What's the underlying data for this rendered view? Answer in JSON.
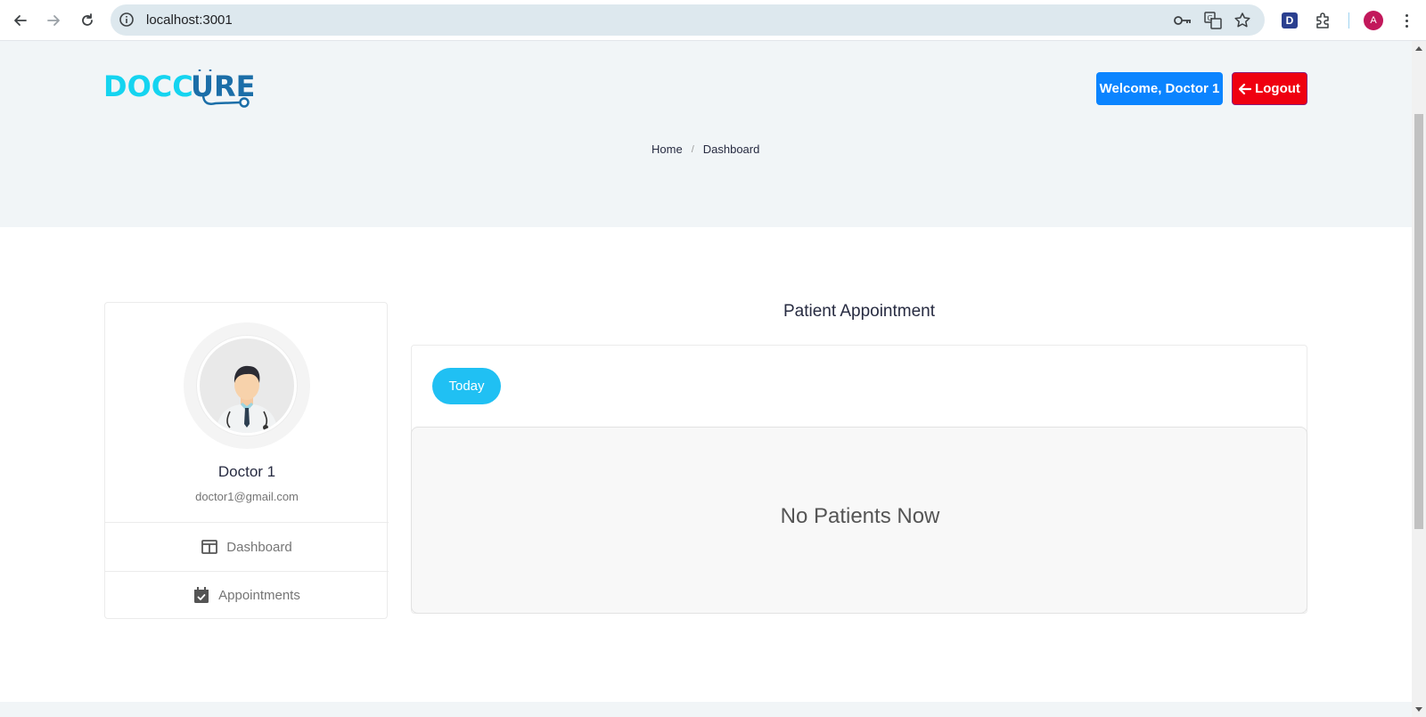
{
  "browser": {
    "url": "localhost:3001",
    "profile_initial": "A",
    "ext_d_label": "D"
  },
  "header": {
    "logo_part1": "DOCC",
    "logo_part2": "URE",
    "welcome_label": "Welcome, Doctor 1",
    "logout_label": "Logout",
    "breadcrumb": {
      "home": "Home",
      "separator": "/",
      "current": "Dashboard"
    }
  },
  "profile": {
    "name": "Doctor 1",
    "email": "doctor1@gmail.com",
    "menu": [
      {
        "label": "Dashboard",
        "icon": "columns-icon"
      },
      {
        "label": "Appointments",
        "icon": "calendar-check-icon"
      }
    ]
  },
  "main": {
    "title": "Patient Appointment",
    "filter_label": "Today",
    "empty_message": "No Patients Now"
  },
  "colors": {
    "primary": "#0b84ff",
    "danger": "#ef0010",
    "accent": "#20c0f3",
    "logo_light": "#15d4f0",
    "logo_dark": "#1b6ea8"
  }
}
